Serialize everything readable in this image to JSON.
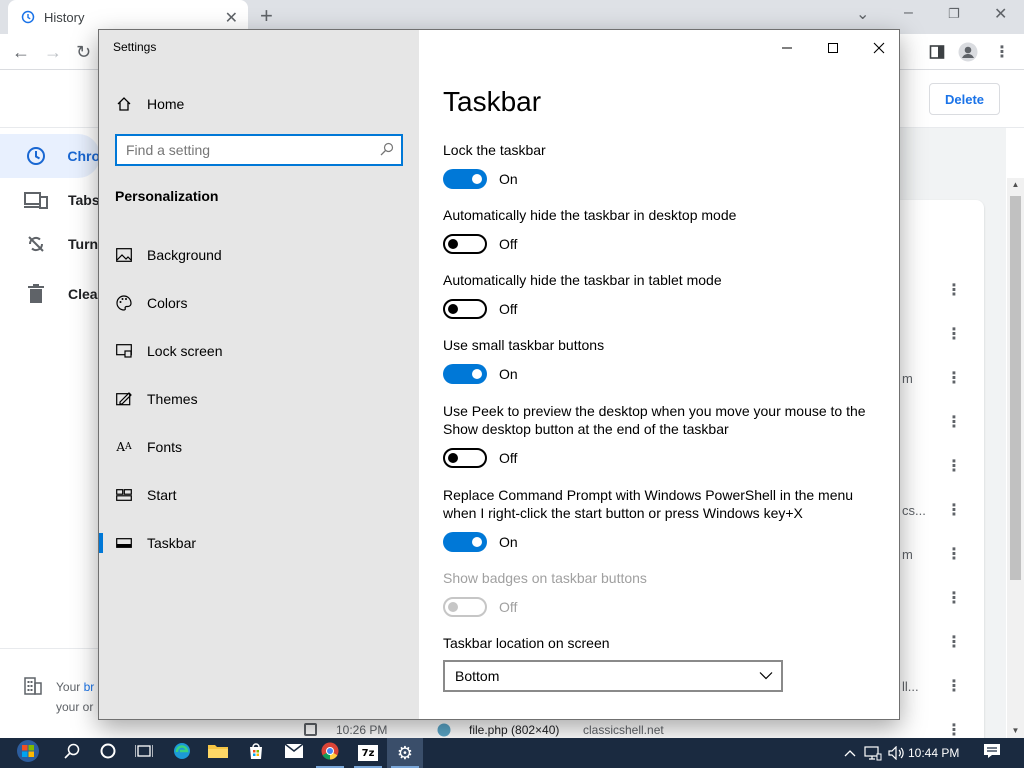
{
  "chrome": {
    "tab_title": "History",
    "new_tab": "+",
    "delete_label": "Delete",
    "sidebar": [
      {
        "label": "Chro",
        "icon": "clock-icon",
        "active": true
      },
      {
        "label": "Tabs",
        "icon": "devices-icon",
        "active": false
      },
      {
        "label": "Turn",
        "icon": "sync-off-icon",
        "active": false
      },
      {
        "label": "Clea",
        "icon": "trash-icon",
        "active": false
      }
    ],
    "footer_line1_prefix": "Your ",
    "footer_line1_link": "br",
    "footer_line2": "your or",
    "truncated_right": [
      "m",
      "cs...",
      "m",
      "ll..."
    ],
    "bottom_row": {
      "time": "10:26 PM",
      "title": "file.php (802×40)",
      "domain": "classicshell.net"
    }
  },
  "settings": {
    "window_title": "Settings",
    "home_label": "Home",
    "search_placeholder": "Find a setting",
    "section_header": "Personalization",
    "nav_items": [
      {
        "label": "Background",
        "icon": "picture-icon"
      },
      {
        "label": "Colors",
        "icon": "palette-icon"
      },
      {
        "label": "Lock screen",
        "icon": "lock-screen-icon"
      },
      {
        "label": "Themes",
        "icon": "themes-icon"
      },
      {
        "label": "Fonts",
        "icon": "fonts-icon"
      },
      {
        "label": "Start",
        "icon": "start-icon"
      },
      {
        "label": "Taskbar",
        "icon": "taskbar-icon"
      }
    ],
    "page_title": "Taskbar",
    "options": [
      {
        "label": "Lock the taskbar",
        "state": "On",
        "on": true
      },
      {
        "label": "Automatically hide the taskbar in desktop mode",
        "state": "Off",
        "on": false
      },
      {
        "label": "Automatically hide the taskbar in tablet mode",
        "state": "Off",
        "on": false
      },
      {
        "label": "Use small taskbar buttons",
        "state": "On",
        "on": true
      },
      {
        "label_line1": "Use Peek to preview the desktop when you move your mouse to the",
        "label_line2": "Show desktop button at the end of the taskbar",
        "state": "Off",
        "on": false
      },
      {
        "label_line1": "Replace Command Prompt with Windows PowerShell in the menu",
        "label_line2": "when I right-click the start button or press Windows key+X",
        "state": "On",
        "on": true
      },
      {
        "label": "Show badges on taskbar buttons",
        "state": "Off",
        "on": false,
        "disabled": true
      }
    ],
    "location_label": "Taskbar location on screen",
    "location_value": "Bottom"
  },
  "taskbar": {
    "time": "10:44 PM",
    "accent": "#0078d7"
  }
}
